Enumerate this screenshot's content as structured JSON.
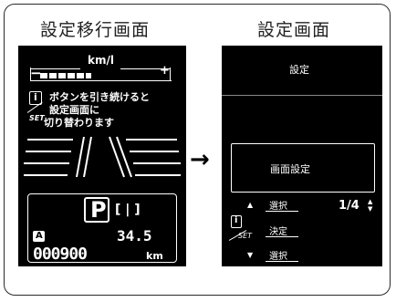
{
  "left_caption": "設定移行画面",
  "right_caption": "設定画面",
  "left_screen": {
    "gauge_unit": "km/l",
    "gauge_minus": "−",
    "gauge_plus": "+",
    "info_icon": "i",
    "set_label": "SET",
    "message_line1": "ボタンを引き続けると",
    "message_line2": "設定画面に",
    "message_line3": "切り替わります",
    "gear": "P",
    "gear_aux": "[ | ]",
    "trip_label": "A",
    "fuel_value": "34.5",
    "odometer_value": "000900",
    "odometer_unit": "km"
  },
  "right_screen": {
    "header": "設定",
    "menu_item": "画面設定",
    "up_arrow": "▲",
    "select_label": "選択",
    "page_indicator": "1/4",
    "page_arrows": "▲▼",
    "info_icon": "i",
    "set_label": "SET",
    "decide_label": "決定",
    "down_arrow": "▼",
    "select_label_2": "選択"
  },
  "transition_arrow": "→"
}
